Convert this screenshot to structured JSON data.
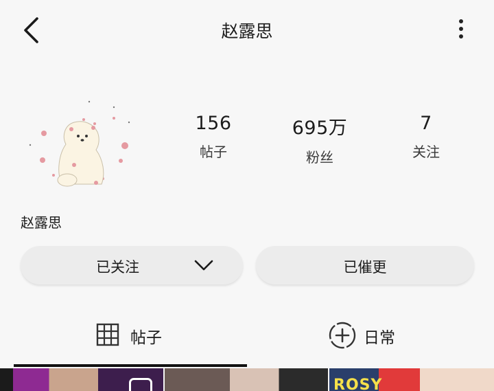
{
  "header": {
    "title": "赵露思"
  },
  "profile": {
    "name": "赵露思",
    "stats": [
      {
        "value": "156",
        "label": "帖子"
      },
      {
        "value": "695万",
        "label": "粉丝"
      },
      {
        "value": "7",
        "label": "关注"
      }
    ]
  },
  "actions": {
    "following_label": "已关注",
    "urged_label": "已催更"
  },
  "tabs": [
    {
      "label": "帖子",
      "icon": "grid-icon",
      "active": true
    },
    {
      "label": "日常",
      "icon": "add-circle-icon",
      "active": false
    }
  ],
  "grid": {
    "thumb3_text": "ROSY"
  },
  "colors": {
    "background": "#f7f7f7",
    "button_bg": "#ececec",
    "indicator": "#111111"
  }
}
